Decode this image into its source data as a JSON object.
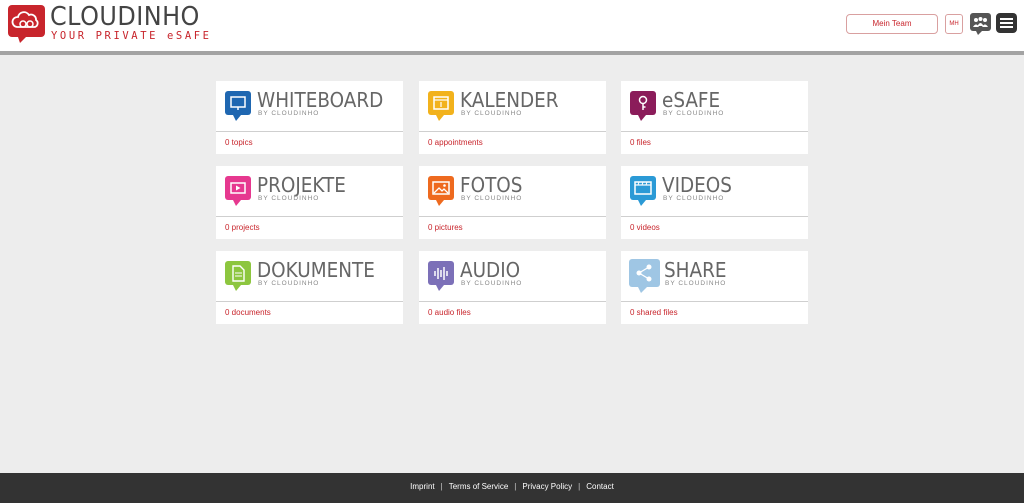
{
  "header": {
    "brand_name": "CLOUDINHO",
    "brand_tagline": "YOUR PRIVATE eSAFE",
    "team_button": "Mein Team",
    "user_initials": "MH",
    "group_icon": "group-icon",
    "menu_icon": "hamburger-menu-icon"
  },
  "colors": {
    "brand_red": "#c8252c",
    "whiteboard": "#1f67b1",
    "kalender": "#f2b21c",
    "esafe": "#8b1c5a",
    "projekte": "#e6388f",
    "fotos": "#ee6a1f",
    "videos": "#2b9ad6",
    "dokumente": "#8dc63f",
    "audio": "#7c70b8",
    "share": "#9fc6e4"
  },
  "tiles": [
    {
      "title": "WHITEBOARD",
      "subtitle": "BY CLOUDINHO",
      "count": "0 topics",
      "icon": "whiteboard-icon"
    },
    {
      "title": "KALENDER",
      "subtitle": "BY CLOUDINHO",
      "count": "0 appointments",
      "icon": "calendar-icon"
    },
    {
      "title": "eSAFE",
      "subtitle": "BY CLOUDINHO",
      "count": "0 files",
      "icon": "safe-icon"
    },
    {
      "title": "PROJEKTE",
      "subtitle": "BY CLOUDINHO",
      "count": "0 projects",
      "icon": "projects-icon"
    },
    {
      "title": "FOTOS",
      "subtitle": "BY CLOUDINHO",
      "count": "0 pictures",
      "icon": "photo-icon"
    },
    {
      "title": "VIDEOS",
      "subtitle": "BY CLOUDINHO",
      "count": "0 videos",
      "icon": "video-icon"
    },
    {
      "title": "DOKUMENTE",
      "subtitle": "BY CLOUDINHO",
      "count": "0 documents",
      "icon": "document-icon"
    },
    {
      "title": "AUDIO",
      "subtitle": "BY CLOUDINHO",
      "count": "0 audio files",
      "icon": "audio-icon"
    },
    {
      "title": "SHARE",
      "subtitle": "BY CLOUDINHO",
      "count": "0 shared files",
      "icon": "share-icon"
    }
  ],
  "footer": {
    "imprint": "Imprint",
    "terms": "Terms of Service",
    "privacy": "Privacy Policy",
    "contact": "Contact",
    "separator": "|"
  }
}
